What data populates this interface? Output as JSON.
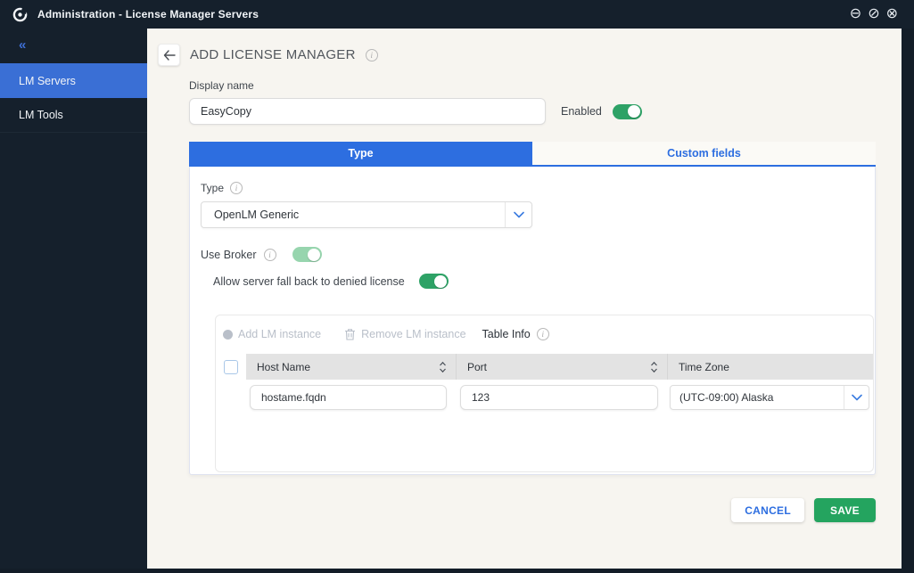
{
  "window": {
    "title": "Administration - License Manager Servers",
    "controls": {
      "minimize_glyph": "⊖",
      "restore_glyph": "⊘",
      "close_glyph": "⊗"
    }
  },
  "sidebar": {
    "collapse_glyph": "«",
    "items": [
      {
        "label": "LM Servers",
        "active": true
      },
      {
        "label": "LM Tools",
        "active": false
      }
    ]
  },
  "page": {
    "title": "ADD LICENSE MANAGER",
    "display_name": {
      "label": "Display name",
      "value": "EasyCopy"
    },
    "enabled": {
      "label": "Enabled",
      "state": "on"
    },
    "tabs": [
      {
        "label": "Type",
        "active": true
      },
      {
        "label": "Custom fields",
        "active": false
      }
    ],
    "type_field": {
      "label": "Type",
      "value": "OpenLM Generic"
    },
    "use_broker": {
      "label": "Use Broker",
      "state": "on"
    },
    "fallback": {
      "label": "Allow server fall back to denied license",
      "state": "on"
    },
    "table": {
      "toolbar": {
        "add_label": "Add LM instance",
        "remove_label": "Remove LM instance",
        "info_label": "Table Info"
      },
      "columns": [
        {
          "label": "Host Name",
          "sortable": true
        },
        {
          "label": "Port",
          "sortable": true
        },
        {
          "label": "Time Zone",
          "sortable": false
        }
      ],
      "rows": [
        {
          "host": "hostame.fqdn",
          "port": "123",
          "timezone": "(UTC-09:00) Alaska"
        }
      ]
    },
    "actions": {
      "cancel_label": "CANCEL",
      "save_label": "SAVE"
    }
  },
  "colors": {
    "titlebar_dark": "#15202c",
    "sidebar_active_blue": "#3a6fd5",
    "accent_blue": "#2d6ee0",
    "page_background": "#f7f5f0",
    "save_green": "#24a45f",
    "toggle_green": "#2ea266",
    "toggle_light_green": "#97d5ae",
    "table_header_gray": "#e3e3e3"
  }
}
